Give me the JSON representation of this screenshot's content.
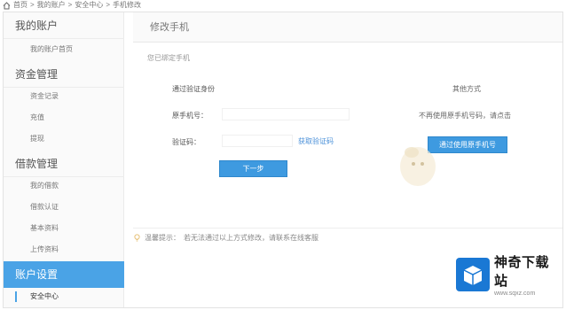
{
  "breadcrumb": {
    "items": [
      "首页",
      "我的账户",
      "安全中心",
      "手机修改"
    ],
    "sep": ">"
  },
  "sidebar": {
    "groups": [
      {
        "label": "我的账户",
        "items": [
          "我的账户首页"
        ]
      },
      {
        "label": "资金管理",
        "items": [
          "资金记录",
          "充值",
          "提现"
        ]
      },
      {
        "label": "借款管理",
        "items": [
          "我的借款",
          "借款认证",
          "基本资料",
          "上传资料"
        ]
      },
      {
        "label": "账户设置",
        "items": [
          "安全中心"
        ]
      }
    ],
    "active_group": "账户设置",
    "current_item": "安全中心"
  },
  "main": {
    "title": "修改手机",
    "bound_prefix": "您已绑定手机",
    "bound_phone": "",
    "verify_via": "通过",
    "verify_via_masked": "",
    "verify_identity": "验证身份",
    "orig_phone_label": "原手机号：",
    "code_label": "验证码：",
    "get_code_label": "获取验证码",
    "next_label": "下一步",
    "other_title": "其他方式",
    "other_desc": "不再使用原手机号码，请点击",
    "other_button": "通过使用原手机号"
  },
  "tip": {
    "prefix": "温馨提示：",
    "text": "若无法通过以上方式修改，请联系在线客服",
    "link": "联系在线客服"
  },
  "watermark": {
    "name": "神奇下载站",
    "url": "www.sqxz.com"
  },
  "colors": {
    "accent": "#4aa3e6",
    "button": "#3e9ae0",
    "link": "#4a90d9",
    "watermark_logo": "#1a78d4"
  }
}
